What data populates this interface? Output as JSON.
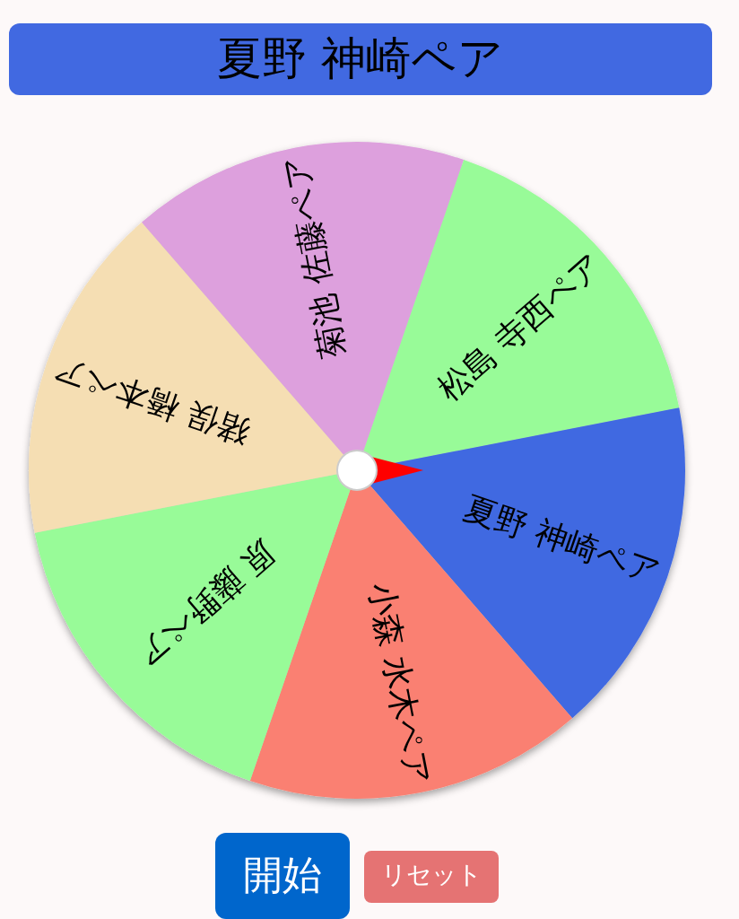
{
  "result_title": "夏野 神崎ペア",
  "wheel": {
    "segments": [
      {
        "label": "菊池 佐藤ペア",
        "color": "#dda0dd"
      },
      {
        "label": "松島 寺西ペア",
        "color": "#98fb98"
      },
      {
        "label": "夏野 神崎ペア",
        "color": "#4169e1"
      },
      {
        "label": "小森 水木ペア",
        "color": "#fa8072"
      },
      {
        "label": "原 藤野ペア",
        "color": "#98fb98"
      },
      {
        "label": "猪俣 橋本ペア",
        "color": "#f5deb3"
      }
    ]
  },
  "buttons": [
    {
      "kind": "start",
      "label": "開始"
    },
    {
      "kind": "reset",
      "label": "リセット"
    }
  ]
}
